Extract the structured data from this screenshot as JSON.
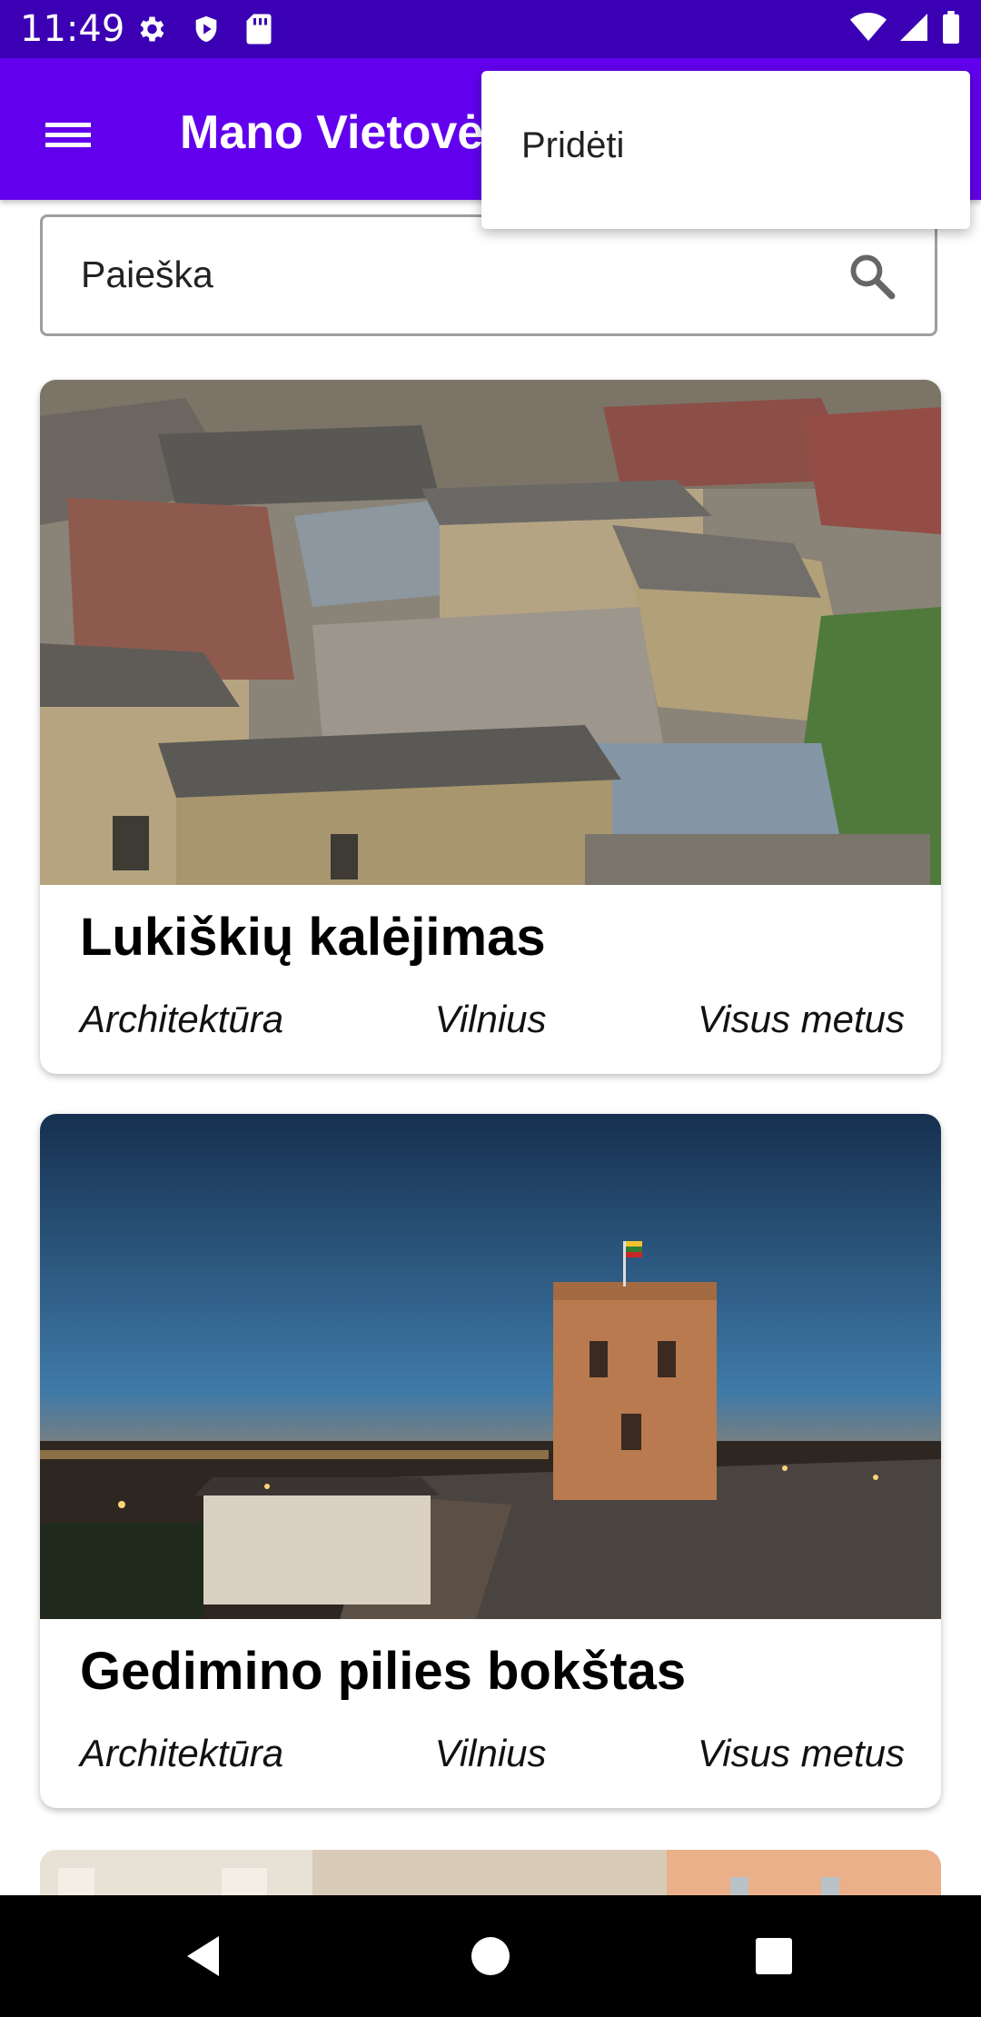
{
  "status_bar": {
    "time": "11:49"
  },
  "app_bar": {
    "title": "Mano Vietovės"
  },
  "overflow_menu": {
    "items": [
      "Pridėti"
    ]
  },
  "search": {
    "placeholder": "Paieška"
  },
  "places": [
    {
      "title": "Lukiškių kalėjimas",
      "category": "Architektūra",
      "city": "Vilnius",
      "season": "Visus metus"
    },
    {
      "title": "Gedimino pilies bokštas",
      "category": "Architektūra",
      "city": "Vilnius",
      "season": "Visus metus"
    }
  ],
  "colors": {
    "status_bar": "#3b00b3",
    "app_bar": "#6200ee",
    "nav_bar": "#000000"
  },
  "icons": [
    "gear-icon",
    "shield-icon",
    "sd-card-icon",
    "wifi-icon",
    "signal-icon",
    "battery-icon",
    "menu-icon",
    "search-icon",
    "back-icon",
    "home-icon",
    "recents-icon"
  ]
}
